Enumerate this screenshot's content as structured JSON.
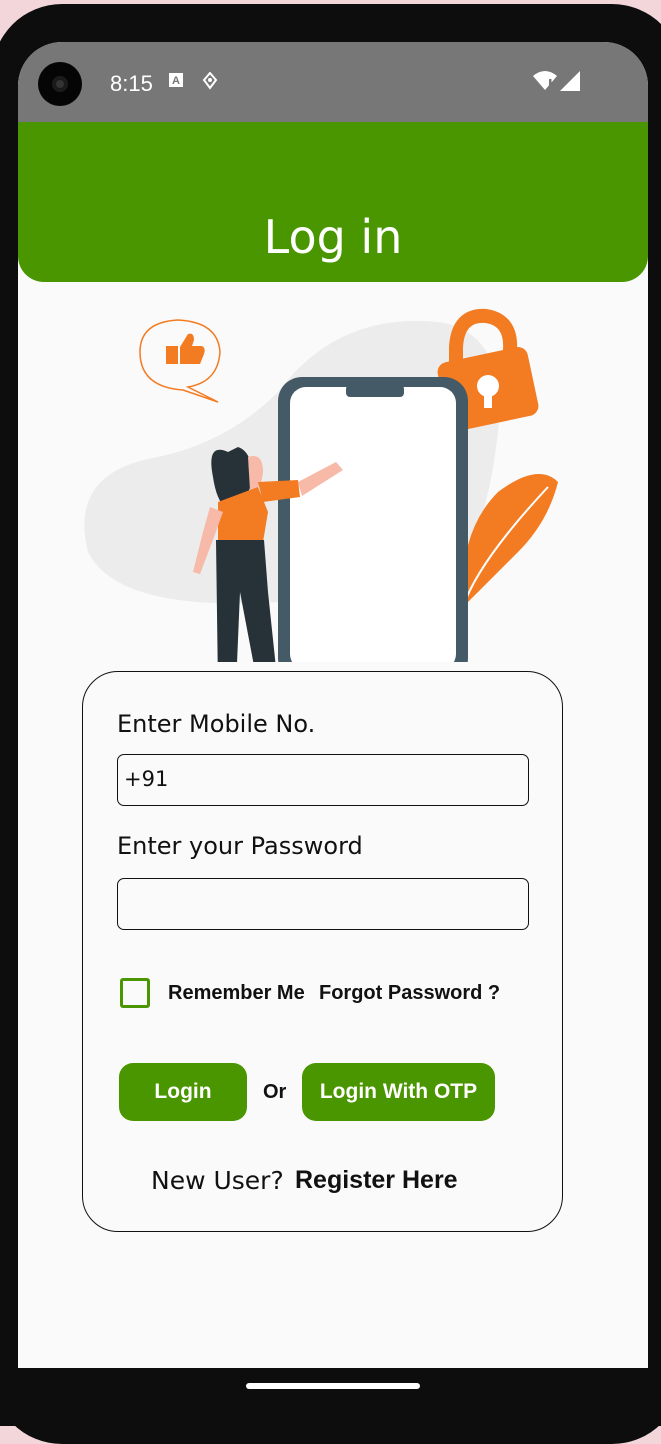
{
  "status_bar": {
    "time": "8:15",
    "icons": [
      "text-a-icon",
      "location-icon",
      "wifi-icon",
      "signal-icon"
    ]
  },
  "header": {
    "title": "Log in",
    "color": "#4a9600"
  },
  "form": {
    "mobile_label": "Enter Mobile No.",
    "mobile_value": "+91",
    "password_label": "Enter your Password",
    "password_value": "",
    "remember_me": "Remember Me",
    "remember_checked": false,
    "forgot_password": "Forgot Password ?",
    "login_button": "Login",
    "or_text": "Or",
    "otp_button": "Login With OTP",
    "new_user_text": "New User?",
    "register_link": "Register Here"
  },
  "colors": {
    "accent": "#4a9600",
    "illustration_orange": "#f37b22",
    "status_bar": "#777777"
  }
}
